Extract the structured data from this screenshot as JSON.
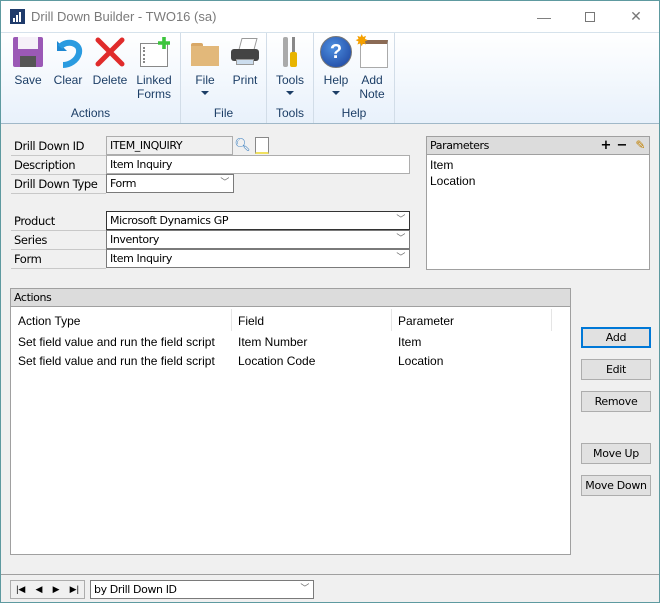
{
  "window": {
    "title": "Drill Down Builder  -  TWO16 (sa)",
    "controls": [
      "minimize",
      "maximize",
      "close"
    ]
  },
  "ribbon": {
    "groups": [
      {
        "label": "Actions",
        "buttons": [
          {
            "label": "Save",
            "icon": "floppy-disk-icon"
          },
          {
            "label": "Clear",
            "icon": "undo-arrow-icon"
          },
          {
            "label": "Delete",
            "icon": "red-x-icon"
          },
          {
            "label": "Linked Forms",
            "line1": "Linked",
            "line2": "Forms",
            "icon": "linked-forms-icon"
          }
        ]
      },
      {
        "label": "File",
        "buttons": [
          {
            "label": "File",
            "icon": "folder-icon",
            "dropdown": true
          },
          {
            "label": "Print",
            "icon": "printer-icon"
          }
        ]
      },
      {
        "label": "Tools",
        "buttons": [
          {
            "label": "Tools",
            "icon": "tools-icon",
            "dropdown": true
          }
        ]
      },
      {
        "label": "Help",
        "buttons": [
          {
            "label": "Help",
            "icon": "help-icon",
            "dropdown": true
          },
          {
            "label": "Add Note",
            "line1": "Add",
            "line2": "Note",
            "icon": "note-icon"
          }
        ]
      }
    ]
  },
  "form": {
    "drill_down_id": {
      "label": "Drill Down ID",
      "value": "ITEM_INQUIRY"
    },
    "description": {
      "label": "Description",
      "value": "Item Inquiry"
    },
    "drill_down_type": {
      "label": "Drill Down Type",
      "value": "Form"
    },
    "product": {
      "label": "Product",
      "value": "Microsoft Dynamics GP"
    },
    "series": {
      "label": "Series",
      "value": "Inventory"
    },
    "form": {
      "label": "Form",
      "value": "Item Inquiry"
    }
  },
  "parameters": {
    "title": "Parameters",
    "add": "+",
    "remove": "−",
    "items": [
      "Item",
      "Location"
    ]
  },
  "actions": {
    "title": "Actions",
    "columns": [
      "Action Type",
      "Field",
      "Parameter"
    ],
    "rows": [
      [
        "Set field value and run the field script",
        "Item Number",
        "Item"
      ],
      [
        "Set field value and run the field script",
        "Location Code",
        "Location"
      ]
    ],
    "buttons": {
      "add": "Add",
      "edit": "Edit",
      "remove": "Remove",
      "move_up": "Move Up",
      "move_down": "Move Down"
    }
  },
  "status": {
    "sort_by": "by Drill Down ID",
    "nav": [
      "|◀",
      "◀",
      "▶",
      "▶|"
    ]
  }
}
